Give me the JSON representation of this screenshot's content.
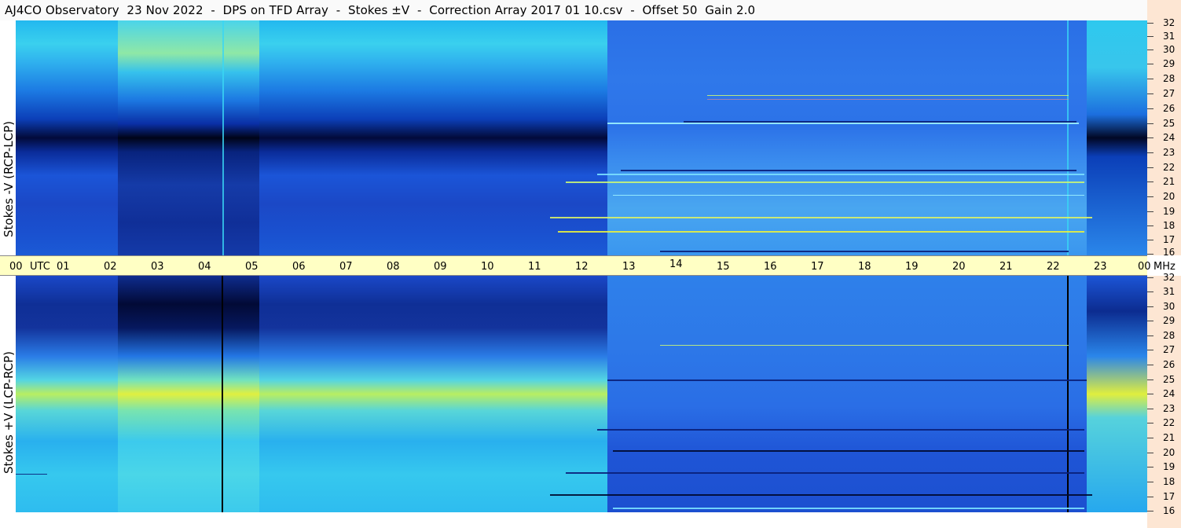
{
  "header": {
    "title": "AJ4CO Observatory  23 Nov 2022  -  DPS on TFD Array  -  Stokes ±V  -  Correction Array 2017 01 10.csv  -  Offset 50  Gain 2.0"
  },
  "panels": {
    "top_label": "Stokes -V (RCP-LCP)",
    "bottom_label": "Stokes +V (LCP-RCP)"
  },
  "time_axis": {
    "labels": [
      "00",
      "UTC",
      "01",
      "02",
      "03",
      "04",
      "05",
      "06",
      "07",
      "08",
      "09",
      "10",
      "11",
      "12",
      "13",
      "14",
      "15",
      "16",
      "17",
      "18",
      "19",
      "20",
      "21",
      "22",
      "23",
      "00",
      "MHz"
    ]
  },
  "freq_axis": {
    "top_labels": [
      "32",
      "31",
      "30",
      "29",
      "28",
      "27",
      "26",
      "25",
      "24",
      "23",
      "22",
      "21",
      "20",
      "19",
      "18",
      "17",
      "16"
    ],
    "bottom_labels": [
      "32",
      "31",
      "30",
      "29",
      "28",
      "27",
      "26",
      "25",
      "24",
      "23",
      "22",
      "21",
      "20",
      "19",
      "18",
      "17",
      "16"
    ]
  },
  "colors": {
    "deep_blue": "#0a1f7a",
    "mid_blue": "#1a5fe0",
    "cyan": "#1fb8f0",
    "green": "#8ee888",
    "yellow": "#e8f040",
    "axis_band": "#ffffc4",
    "freq_band": "#fde6d3"
  }
}
